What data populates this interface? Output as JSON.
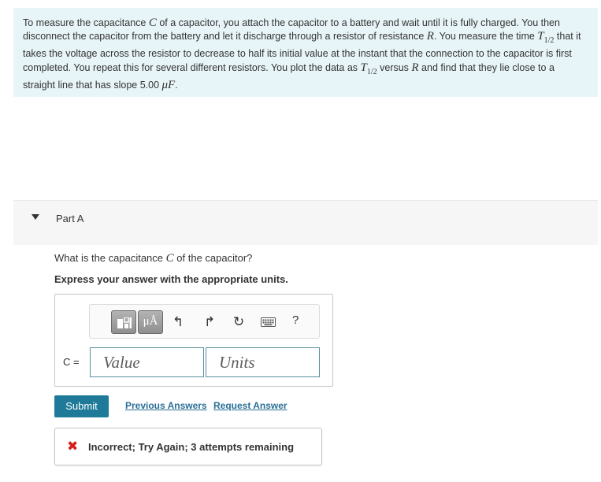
{
  "intro": {
    "s1": "To measure the capacitance ",
    "C": "C",
    "s2": " of a capacitor, you attach the capacitor to a battery and wait until it is fully charged. You then disconnect the capacitor from the battery and let it discharge through a resistor of resistance ",
    "R": "R",
    "s3": ". You measure the time ",
    "T": "T",
    "sub": "1/2",
    "s4": " that it takes the voltage across the resistor to decrease to half its initial value at the instant that the connection to the capacitor is first completed. You repeat this for several different resistors. You plot the data as ",
    "s5": " versus ",
    "s6": " and find that they lie close to a straight line that has slope 5.00 ",
    "unit_mu": "μ",
    "unit_F": "F",
    "s7": "."
  },
  "part": {
    "title": "Part A"
  },
  "question": {
    "text_before": "What is the capacitance ",
    "symbol": "C",
    "text_after": " of the capacitor?"
  },
  "instruction": "Express your answer with the appropriate units.",
  "toolbar": {
    "units_label": "μÅ",
    "undo_symbol": "↰",
    "redo_symbol": "↱",
    "reset_symbol": "↻",
    "help_label": "?"
  },
  "answer": {
    "variable_label": "C =",
    "value_placeholder": "Value",
    "units_placeholder": "Units"
  },
  "actions": {
    "submit_label": "Submit",
    "previous_answers_label": "Previous Answers",
    "request_answer_label": "Request Answer"
  },
  "feedback": {
    "icon": "✖",
    "text": "Incorrect; Try Again; 3 attempts remaining"
  },
  "colors": {
    "intro_bg": "#e8f5f8",
    "submit_bg": "#1e7a98",
    "link": "#2a6f96",
    "error": "#d51f1f"
  }
}
